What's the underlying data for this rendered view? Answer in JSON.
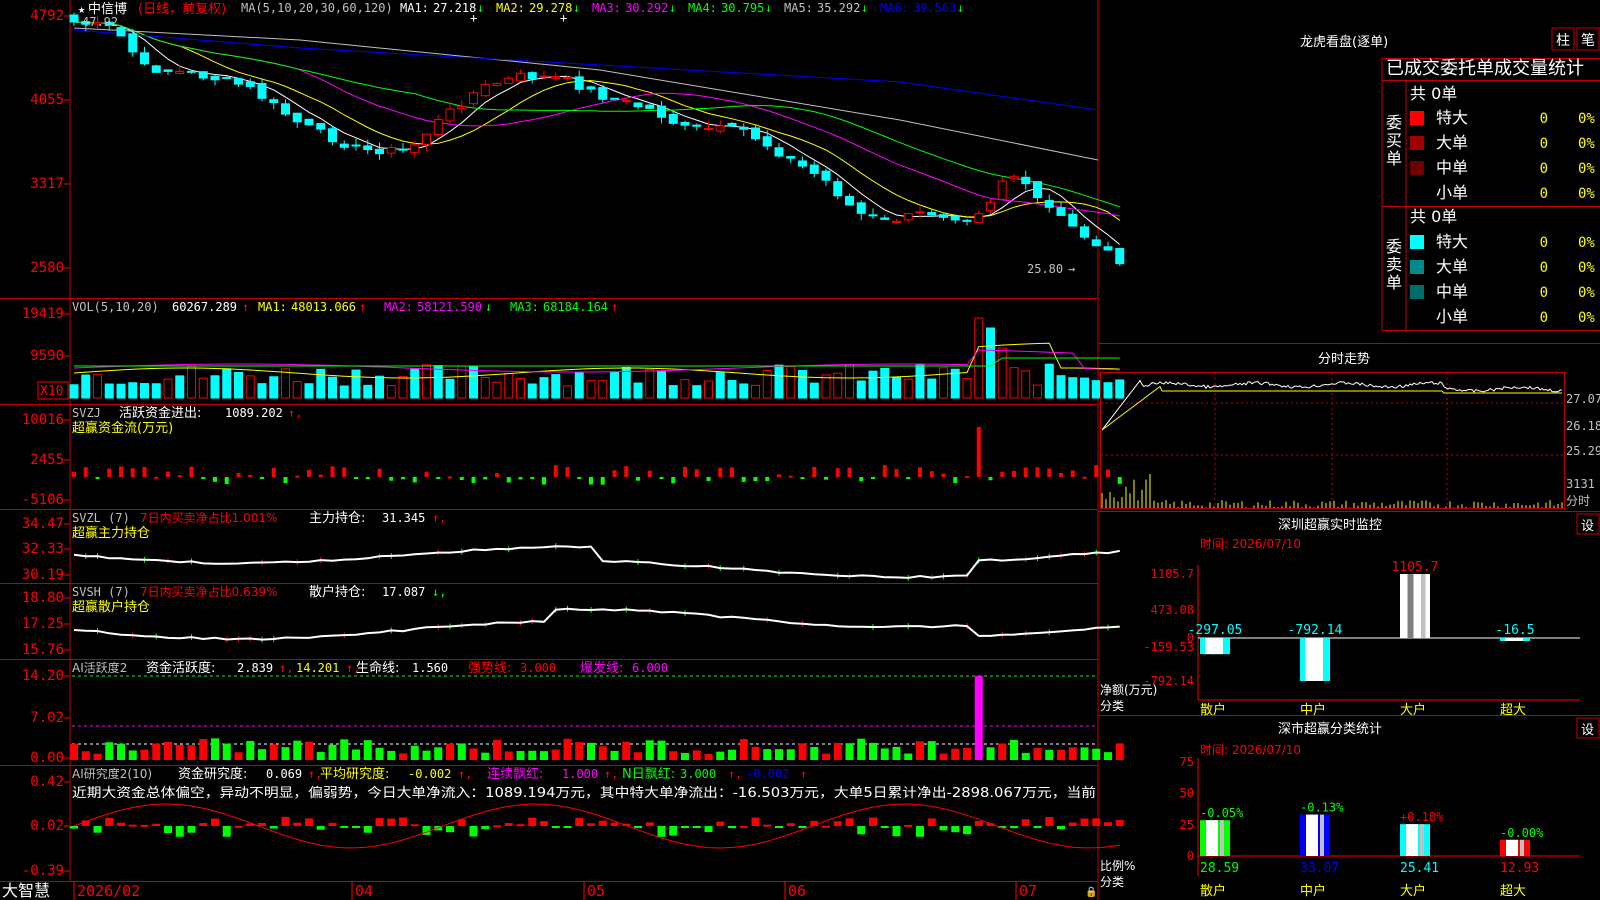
{
  "app": {
    "brand": "大智慧"
  },
  "kline": {
    "stock_name": "中信博",
    "period": "(日线，前复权)",
    "ma_params": "MA(5,10,20,30,60,120)",
    "ma_values": [
      {
        "label": "MA1:",
        "value": "27.218",
        "arrow": "↓",
        "color": "#ffffff"
      },
      {
        "label": "MA2:",
        "value": "29.278",
        "arrow": "↓",
        "color": "#ffff00"
      },
      {
        "label": "MA3:",
        "value": "30.292",
        "arrow": "↓",
        "color": "#ff00ff"
      },
      {
        "label": "MA4:",
        "value": "30.795",
        "arrow": "↓",
        "color": "#00ff00"
      },
      {
        "label": "MA5:",
        "value": "35.292",
        "arrow": "↓",
        "color": "#c0c0c0"
      },
      {
        "label": "MA6:",
        "value": "39.563",
        "arrow": "↓",
        "color": "#0000ff"
      }
    ],
    "high_label": "47.92",
    "low_label": "25.80",
    "y_ticks": [
      "4792",
      "4055",
      "3317",
      "2580"
    ]
  },
  "vol": {
    "title": "VOL(5,10,20)",
    "value": "60267.289",
    "ma": [
      {
        "label": "MA1:",
        "value": "48013.066",
        "arrow": "↑",
        "color": "#ffff00"
      },
      {
        "label": "MA2:",
        "value": "58121.590",
        "arrow": "↓",
        "color": "#ff00ff"
      },
      {
        "label": "MA3:",
        "value": "68184.164",
        "arrow": "↑",
        "color": "#00ff00"
      }
    ],
    "y_ticks": [
      "19419",
      "9590"
    ],
    "unit": "X10"
  },
  "svzj": {
    "title": "SVZJ",
    "line1_label": "活跃资金进出:",
    "line1_value": "1089.202",
    "line2": "超赢资金流(万元)",
    "y_ticks": [
      "10016",
      "2455",
      "-5106"
    ]
  },
  "svzl": {
    "title": "SVZL (7)",
    "label1": "7日内买卖净占比1.001%",
    "label2": "主力持仓:",
    "value2": "31.345",
    "line2": "超赢主力持仓",
    "y_ticks": [
      "34.47",
      "32.33",
      "30.19"
    ]
  },
  "svsh": {
    "title": "SVSH (7)",
    "label1": "7日内买卖净占比0.639%",
    "label2": "散户持仓:",
    "value2": "17.087",
    "line2": "超赢散户持仓",
    "y_ticks": [
      "18.80",
      "17.25",
      "15.76"
    ]
  },
  "ai1": {
    "title": "AI活跃度2",
    "l1": "资金活跃度:",
    "v1": "2.839",
    "v2": "14.201",
    "l3": "生命线:",
    "v3": "1.560",
    "l4": "强势线:",
    "v4": "3.000",
    "l5": "爆发线:",
    "v5": "6.000",
    "y_ticks": [
      "14.20",
      "7.02",
      "0.00"
    ]
  },
  "ai2": {
    "title": "AI研究度2(10)",
    "l1": "资金研究度:",
    "v1": "0.069",
    "l2": "平均研究度:",
    "v2": "-0.002",
    "l3": "连续飘红:",
    "v3": "1.000",
    "l4": "N日飘红:",
    "v4": "3.000",
    "v5": "-0.002",
    "comment": "近期大资金总体偏空，异动不明显，偏弱势，今日大单净流入：1089.194万元，其中特大单净流出：-16.503万元，大单5日累计净出-2898.067万元，当前",
    "y_ticks": [
      "0.42",
      "0.02",
      "-0.39"
    ]
  },
  "x_axis": [
    "2026/02",
    "04",
    "05",
    "06",
    "07"
  ],
  "longhu": {
    "title": "龙虎看盘(逐单)",
    "btn1": "柱",
    "btn2": "笔",
    "subtitle": "已成交委托单成交量统计",
    "buy_side": "委买单",
    "sell_side": "委卖单",
    "buy_total": "共 0单",
    "sell_total": "共 0单",
    "rows": [
      {
        "name": "特大",
        "vol": "0",
        "pct": "0%"
      },
      {
        "name": "大单",
        "vol": "0",
        "pct": "0%"
      },
      {
        "name": "中单",
        "vol": "0",
        "pct": "0%"
      },
      {
        "name": "小单",
        "vol": "0",
        "pct": "0%"
      }
    ],
    "buy_colors": [
      "#ff0000",
      "#a00000",
      "#700000",
      "#000000"
    ],
    "sell_colors": [
      "#00ffff",
      "#008b8b",
      "#006b6b",
      "#000000"
    ]
  },
  "fenshi": {
    "title": "分时走势",
    "y_labels": [
      "27.07",
      "26.18",
      "25.29"
    ],
    "vol_label": "3131",
    "unit": "分时"
  },
  "sz_monitor": {
    "title": "深圳超赢实时监控",
    "settings": "设",
    "time_label": "时间: 2026/07/10",
    "y_labels": [
      "1105.7",
      "473.08",
      "0",
      "-159.53",
      "-792.14"
    ],
    "y_unit1": "净额(万元)",
    "y_unit2": "分类",
    "categories": [
      "散户",
      "中户",
      "大户",
      "超大"
    ],
    "value_labels": [
      "-297.05",
      "-792.14",
      "1105.7",
      "-16.5"
    ]
  },
  "sz_class": {
    "title": "深市超赢分类统计",
    "settings": "设",
    "time_label": "时间: 2026/07/10",
    "y_labels": [
      "75",
      "50",
      "25",
      "0"
    ],
    "y_unit1": "比例%",
    "y_unit2": "分类",
    "categories": [
      "散户",
      "中户",
      "大户",
      "超大"
    ],
    "top_labels": [
      "-0.05%",
      "-0.13%",
      "+0.18%",
      "-0.00%"
    ],
    "bottom_labels": [
      "28.59",
      "33.07",
      "25.41",
      "12.93"
    ]
  },
  "chart_data": [
    {
      "type": "bar",
      "title": "深圳超赢实时监控",
      "categories": [
        "散户",
        "中户",
        "大户",
        "超大"
      ],
      "values": [
        -297.05,
        -792.14,
        1105.7,
        -16.5
      ],
      "ylabel": "净额(万元)",
      "ylim": [
        -792.14,
        1105.7
      ]
    },
    {
      "type": "bar",
      "title": "深市超赢分类统计",
      "categories": [
        "散户",
        "中户",
        "大户",
        "超大"
      ],
      "values": [
        28.59,
        33.07,
        25.41,
        12.93
      ],
      "changes": [
        "-0.05%",
        "-0.13%",
        "+0.18%",
        "-0.00%"
      ],
      "ylabel": "比例%",
      "ylim": [
        0,
        75
      ]
    }
  ]
}
